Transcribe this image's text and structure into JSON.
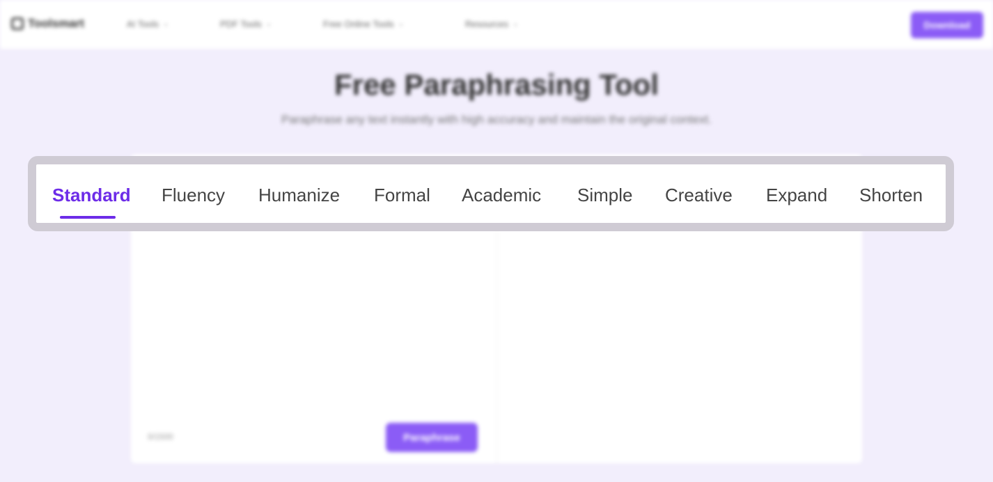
{
  "nav": {
    "logo": "Toolsmart",
    "items": [
      {
        "label": "AI Tools"
      },
      {
        "label": "PDF Tools"
      },
      {
        "label": "Free Online Tools"
      },
      {
        "label": "Resources"
      }
    ],
    "download_label": "Download"
  },
  "hero": {
    "title": "Free Paraphrasing Tool",
    "subtitle": "Paraphrase any text instantly with high accuracy and maintain the original context."
  },
  "modes": {
    "active": "Standard",
    "tabs": [
      {
        "label": "Standard"
      },
      {
        "label": "Fluency"
      },
      {
        "label": "Humanize"
      },
      {
        "label": "Formal"
      },
      {
        "label": "Academic"
      },
      {
        "label": "Simple"
      },
      {
        "label": "Creative"
      },
      {
        "label": "Expand"
      },
      {
        "label": "Shorten"
      }
    ]
  },
  "editor": {
    "word_count": "0/1500",
    "paraphrase_label": "Paraphrase"
  },
  "colors": {
    "accent": "#6d2ce8",
    "button": "#8b5cf6",
    "background": "#f2eefc",
    "highlight_border": "#cfcbd4"
  }
}
